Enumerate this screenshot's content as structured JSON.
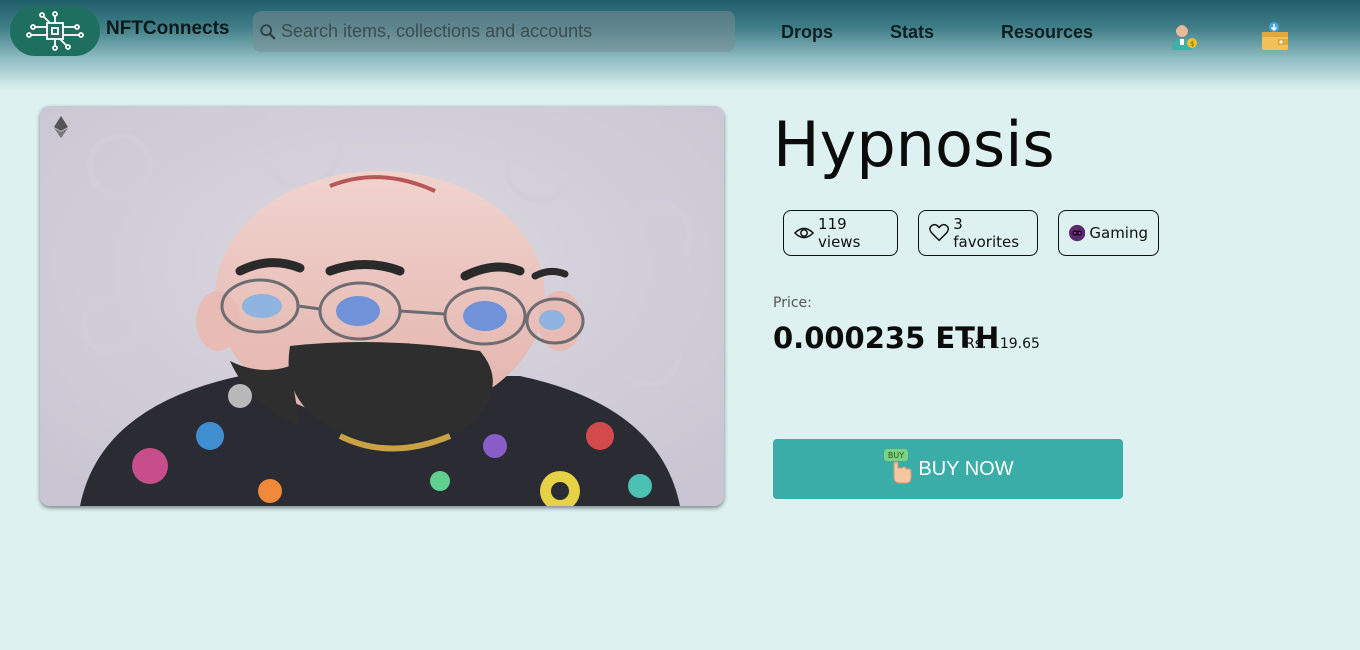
{
  "header": {
    "brand": "NFTConnects",
    "search_placeholder": "Search items, collections and accounts",
    "nav": [
      "Drops",
      "Stats",
      "Resources"
    ]
  },
  "item": {
    "title": "Hypnosis",
    "views": "119 views",
    "favorites": "3 favorites",
    "category": "Gaming",
    "price_label": "Price:",
    "price": "0.000235 ETH",
    "price_fiat": "Rs. 119.65",
    "buy_label": "BUY NOW",
    "buy_badge": "BUY"
  },
  "colors": {
    "accent": "#3aada8",
    "logo_bg": "#1e6f60",
    "page_bg": "#ddf1f0"
  },
  "icons": [
    "circuit-logo",
    "search-icon",
    "profile-icon",
    "wallet-icon",
    "ethereum-icon",
    "eye-icon",
    "heart-icon",
    "gamepad-icon",
    "pointer-hand-icon"
  ]
}
